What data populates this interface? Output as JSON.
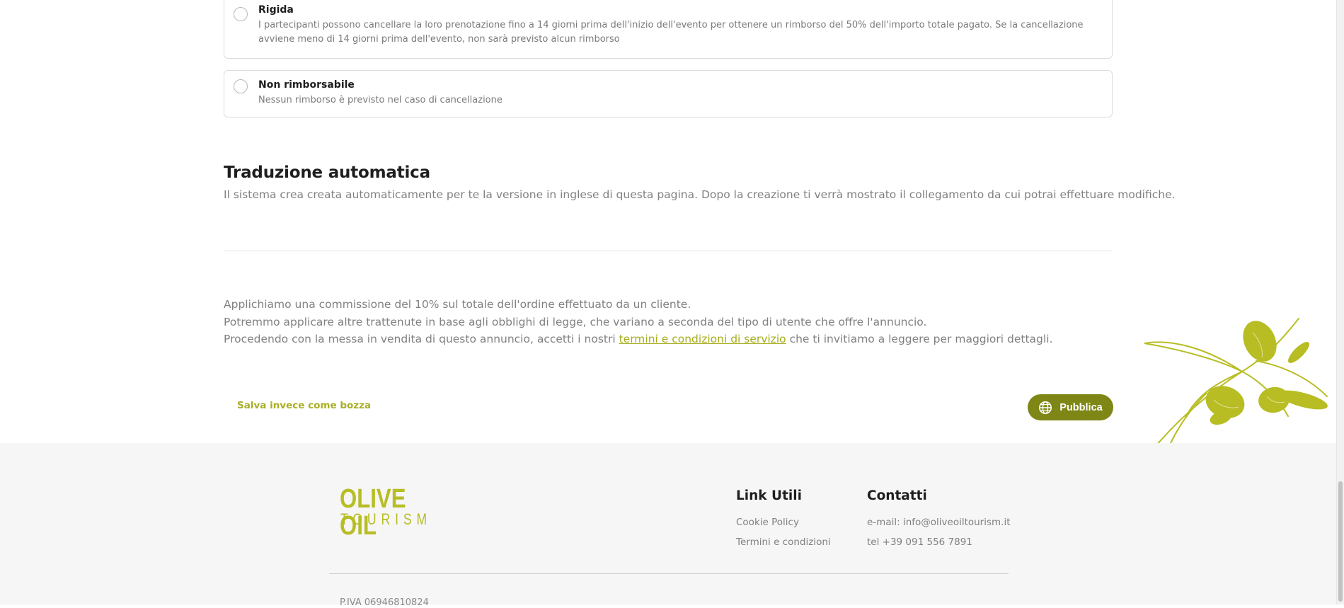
{
  "refund_options": [
    {
      "title": "Rigida",
      "description": "I partecipanti possono cancellare la loro prenotazione fino a 14 giorni prima dell'inizio dell'evento per ottenere un rimborso del 50% dell'importo totale pagato. Se la cancellazione avviene meno di 14 giorni prima dell'evento, non sarà previsto alcun rimborso",
      "selected": false
    },
    {
      "title": "Non rimborsabile",
      "description": "Nessun rimborso è previsto nel caso di cancellazione",
      "selected": false
    }
  ],
  "translation": {
    "title": "Traduzione automatica",
    "text": "Il sistema crea creata automaticamente per te la versione in inglese di questa pagina. Dopo la creazione ti verrà mostrato il collegamento da cui potrai effettuare modifiche."
  },
  "commission": {
    "line1": "Applichiamo una commissione del 10% sul totale dell'ordine effettuato da un cliente.",
    "line2": "Potremmo applicare altre trattenute in base agli obblighi di legge, che variano a seconda del tipo di utente che offre l'annuncio.",
    "line3_before": "Procedendo con la messa in vendita di questo annuncio, accetti i nostri ",
    "line3_link": "termini e condizioni di servizio",
    "line3_after": " che ti invitiamo a leggere per maggiori dettagli."
  },
  "actions": {
    "draft_label": "Salva invece come bozza",
    "publish_label": "Pubblica",
    "publish_icon": "globe-icon"
  },
  "footer": {
    "logo_line1": "OLIVE OIL",
    "logo_line2": "TOURISM",
    "links_title": "Link Utili",
    "links": [
      "Cookie Policy",
      "Termini e condizioni"
    ],
    "contacts_title": "Contatti",
    "contacts": [
      "e-mail: info@oliveoiltourism.it",
      "tel +39 091 556 7891"
    ],
    "piva": "P.IVA 06946810824"
  },
  "colors": {
    "accent": "#a8ae24",
    "button": "#7e8616",
    "olive_art": "#b7bd23",
    "footer_bg": "#f6f6f6"
  }
}
